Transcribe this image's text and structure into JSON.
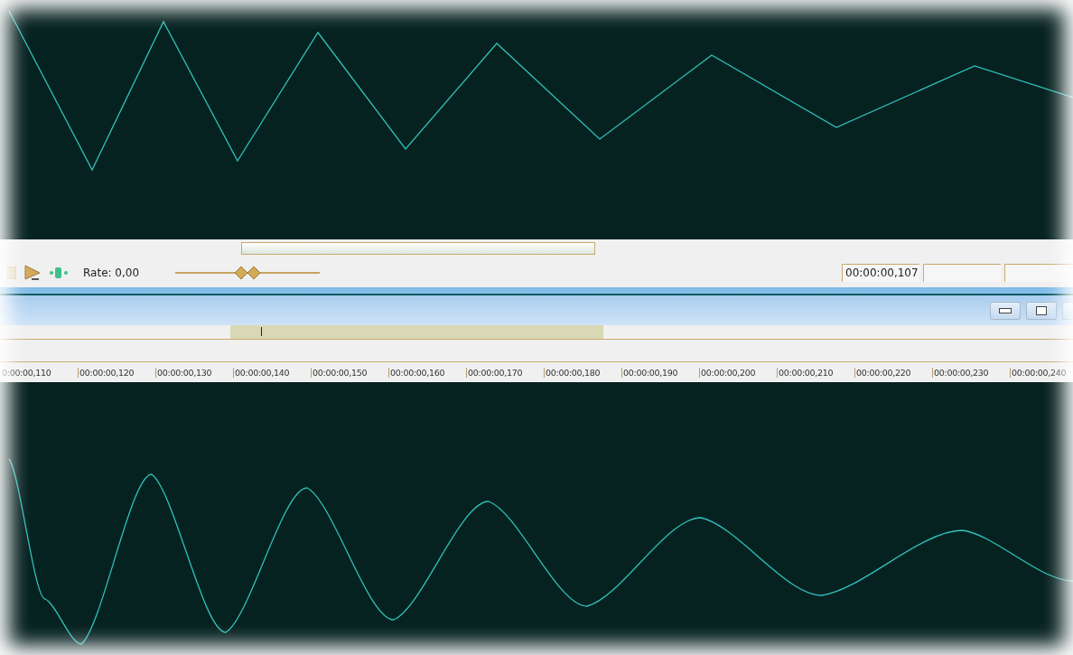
{
  "transport": {
    "rate_label": "Rate: 0,00",
    "rate_slider": {
      "level": 0.5
    },
    "time_field": {
      "value": "00:00:00,107"
    }
  },
  "ruler": {
    "labels": [
      "0:00:00,110",
      "00:00:00,120",
      "00:00:00,130",
      "00:00:00,140",
      "00:00:00,150",
      "00:00:00,160",
      "00:00:00,170",
      "00:00:00,180",
      "00:00:00,190",
      "00:00:00,200",
      "00:00:00,210",
      "00:00:00,220",
      "00:00:00,230",
      "00:00:00,240"
    ]
  }
}
